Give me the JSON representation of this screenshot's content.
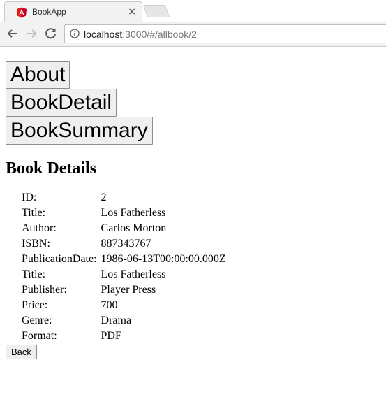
{
  "browser": {
    "tab_title": "BookApp",
    "tab_close": "×",
    "url_host": "localhost",
    "url_rest": ":3000/#/allbook/2"
  },
  "nav": {
    "about_label": "About",
    "book_detail_label": "BookDetail",
    "book_summary_label": "BookSummary"
  },
  "page": {
    "title": "Book Details",
    "back_label": "Back"
  },
  "details": [
    {
      "label": "ID:",
      "value": "2"
    },
    {
      "label": "Title:",
      "value": "Los Fatherless"
    },
    {
      "label": "Author:",
      "value": "Carlos Morton"
    },
    {
      "label": "ISBN:",
      "value": "887343767"
    },
    {
      "label": "PublicationDate:",
      "value": "1986-06-13T00:00:00.000Z"
    },
    {
      "label": "Title:",
      "value": "Los Fatherless"
    },
    {
      "label": "Publisher:",
      "value": "Player Press"
    },
    {
      "label": "Price:",
      "value": "700"
    },
    {
      "label": "Genre:",
      "value": "Drama"
    },
    {
      "label": "Format:",
      "value": "PDF"
    }
  ],
  "colors": {
    "angular_red": "#dd1b16",
    "chrome_bg": "#f2f2f2"
  }
}
